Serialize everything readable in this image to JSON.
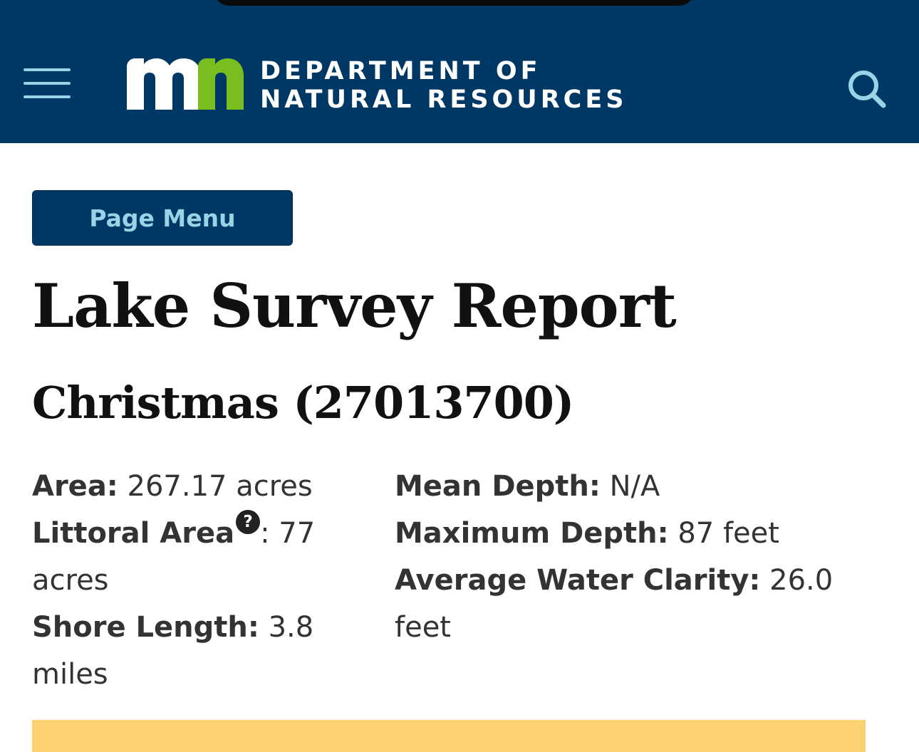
{
  "header": {
    "menu_icon": "hamburger-menu-icon",
    "logo_icon": "mn-logo",
    "logo_text": "mn",
    "dept_line1": "DEPARTMENT OF",
    "dept_line2": "NATURAL RESOURCES",
    "search_icon": "search-icon",
    "colors": {
      "background": "#003865",
      "accent": "#9ad3e6",
      "logo_white": "#ffffff",
      "logo_green": "#78be21"
    }
  },
  "page_menu": {
    "label": "Page Menu"
  },
  "page": {
    "title": "Lake Survey Report",
    "lake_name": "Christmas (27013700)"
  },
  "stats": {
    "left": [
      {
        "label": "Area:",
        "value": " 267.17 acres"
      },
      {
        "label": "Littoral Area",
        "help_icon": "question-mark-icon",
        "help_text": "?",
        "value": ": 77 acres"
      },
      {
        "label": "Shore Length:",
        "value": " 3.8 miles"
      }
    ],
    "right": [
      {
        "label": "Mean Depth:",
        "value": " N/A"
      },
      {
        "label": "Maximum Depth:",
        "value": " 87 feet"
      },
      {
        "label": "Average Water Clarity:",
        "value": " 26.0 feet"
      }
    ]
  },
  "alert_bar": {
    "color": "#fcd171"
  }
}
